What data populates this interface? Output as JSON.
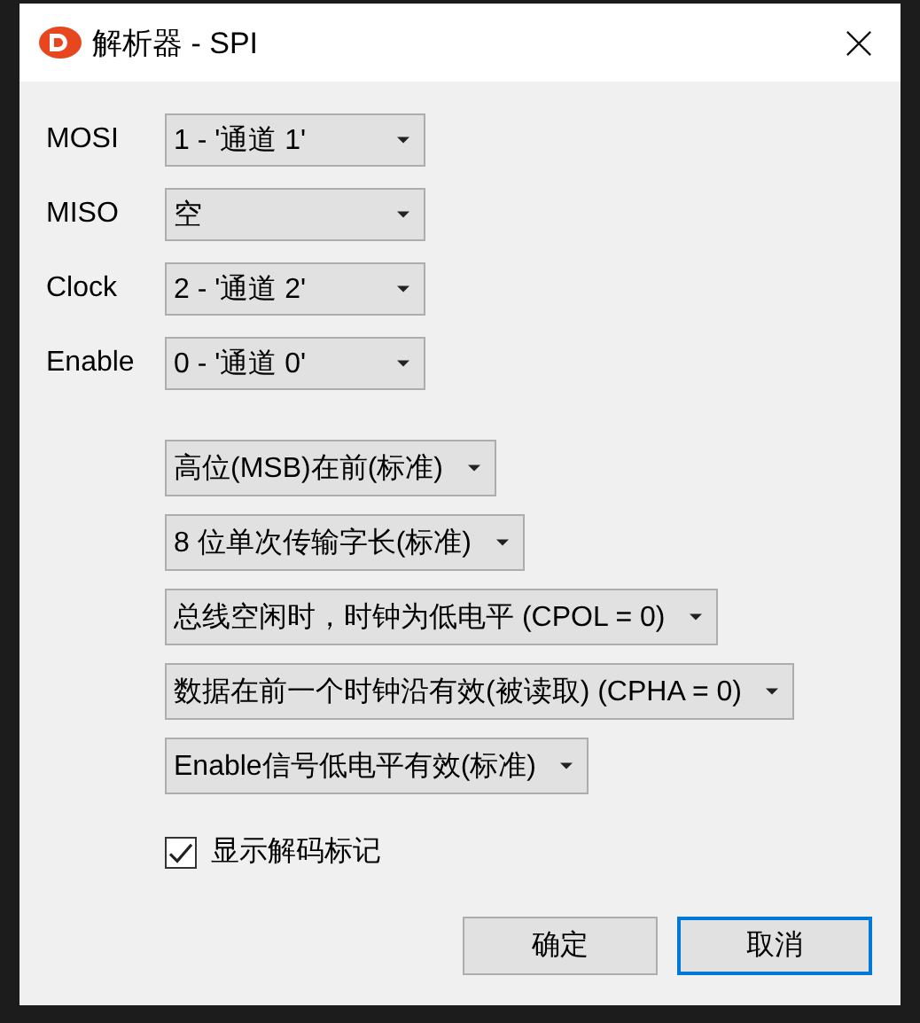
{
  "window": {
    "title": "解析器 - SPI"
  },
  "signals": [
    {
      "label": "MOSI",
      "value": "1 - '通道 1'"
    },
    {
      "label": "MISO",
      "value": "空"
    },
    {
      "label": "Clock",
      "value": "2 - '通道 2'"
    },
    {
      "label": "Enable",
      "value": "0 - '通道 0'"
    }
  ],
  "options": [
    {
      "value": "高位(MSB)在前(标准)"
    },
    {
      "value": "8 位单次传输字长(标准)"
    },
    {
      "value": "总线空闲时，时钟为低电平 (CPOL = 0)"
    },
    {
      "value": "数据在前一个时钟沿有效(被读取) (CPHA = 0)"
    },
    {
      "value": "Enable信号低电平有效(标准)"
    }
  ],
  "checkbox": {
    "label": "显示解码标记",
    "checked": true
  },
  "buttons": [
    {
      "label": "确定",
      "focused": false
    },
    {
      "label": "取消",
      "focused": true
    }
  ]
}
